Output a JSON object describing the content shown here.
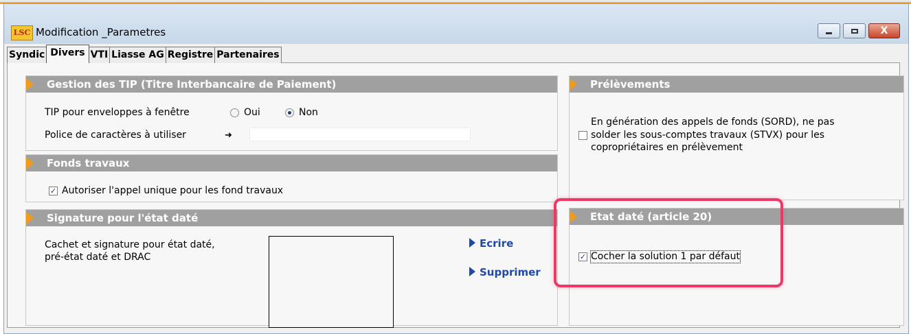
{
  "window": {
    "logo_text": "LSC",
    "title": "Modification _Parametres",
    "close_symbol": "X"
  },
  "tabs": [
    "Syndic",
    "Divers",
    "VTI",
    "Liasse AG",
    "Registre",
    "Partenaires"
  ],
  "active_tab": "Divers",
  "tip": {
    "header": "Gestion des TIP (Titre Interbancaire de Paiement)",
    "enveloppe_label": "TIP pour enveloppes à fenêtre",
    "oui_label": "Oui",
    "non_label": "Non",
    "selected": "Non",
    "police_label": "Police de caractères à utiliser",
    "police_arrow": "➜",
    "police_value": ""
  },
  "fonds": {
    "header": "Fonds travaux",
    "checkbox_label": "Autoriser l'appel unique pour les fond travaux",
    "checked": true
  },
  "signature": {
    "header": "Signature pour l'état daté",
    "text_line1": "Cachet et signature pour état daté,",
    "text_line2": "pré-état daté et DRAC",
    "ecrire_label": "Ecrire",
    "supprimer_label": "Supprimer"
  },
  "prelevements": {
    "header": "Prélèvements",
    "line1": "En génération des appels de fonds (SORD), ne pas",
    "line2": "solder les sous-comptes travaux (STVX) pour les",
    "line3": "copropriétaires en prélèvement",
    "checked": false
  },
  "etat_date": {
    "header": "Etat daté (article 20)",
    "checkbox_label": "Cocher la solution 1 par défaut",
    "checked": true
  },
  "colors": {
    "header_bg": "#a0a0a0",
    "header_arrow": "#f29a1a",
    "link": "#1f4aa8",
    "highlight": "#ee3967"
  }
}
